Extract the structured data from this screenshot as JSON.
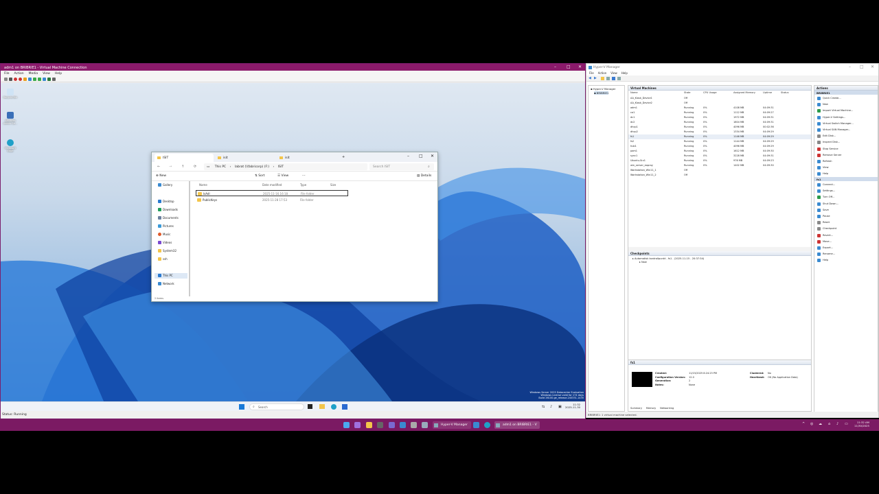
{
  "vm_window": {
    "title": "adm1 on BRIBRIE1 - Virtual Machine Connection",
    "menu": [
      "File",
      "Action",
      "Media",
      "View",
      "Help"
    ],
    "status": "Status: Running"
  },
  "desktop": {
    "icons": [
      "Recycle Bin",
      "Windows Admin Ce...",
      "Microsoft Edge"
    ],
    "watermark": [
      "Windows Server 2025 Datacenter Evaluation",
      "Windows License valid for 174 days",
      "Build 26100.ge_release.240331-1435"
    ],
    "taskbar": {
      "search": "Search",
      "time": "11:32",
      "date": "2025-11-30"
    }
  },
  "explorer": {
    "tabs": [
      "ISIT",
      "isit",
      "isit"
    ],
    "new_tab": "+",
    "address": [
      "This PC",
      "labrat (\\\\fabricorp) (F:)",
      "ISIT"
    ],
    "search_placeholder": "Search ISIT",
    "commands": {
      "new": "New",
      "sort": "Sort",
      "view": "View",
      "more": "···",
      "details": "Details"
    },
    "nav": [
      "Gallery",
      "Desktop",
      "Downloads",
      "Documents",
      "Pictures",
      "Music",
      "Videos",
      "System32",
      "ssh",
      "This PC",
      "Network"
    ],
    "columns": [
      "Name",
      "Date modified",
      "Type",
      "Size"
    ],
    "files": [
      {
        "name": "IsAdl",
        "date": "2025-11-16 16:18",
        "type": "File folder"
      },
      {
        "name": "PublicKeys",
        "date": "2025-11-28 17:53",
        "type": "File folder"
      }
    ],
    "status": "2 items"
  },
  "hyperv": {
    "title": "Hyper-V Manager",
    "menu": [
      "File",
      "Action",
      "View",
      "Help"
    ],
    "tree": [
      "Hyper-V Manager",
      "BRIBRIE1"
    ],
    "vm_section": "Virtual Machines",
    "columns": [
      "Name",
      "State",
      "CPU Usage",
      "Assigned Memory",
      "Uptime",
      "Status"
    ],
    "vms": [
      {
        "name": "AA_Kiosk_Device1",
        "state": "Off",
        "cpu": "",
        "mem": "",
        "up": ""
      },
      {
        "name": "AA_Kiosk_Device2",
        "state": "Off",
        "cpu": "",
        "mem": "",
        "up": ""
      },
      {
        "name": "adm1",
        "state": "Running",
        "cpu": "0%",
        "mem": "4108 MB",
        "up": "04:09:31"
      },
      {
        "name": "ca1",
        "state": "Running",
        "cpu": "0%",
        "mem": "1112 MB",
        "up": "04:09:27"
      },
      {
        "name": "dc1",
        "state": "Running",
        "cpu": "0%",
        "mem": "1972 MB",
        "up": "04:09:31"
      },
      {
        "name": "dc2",
        "state": "Running",
        "cpu": "0%",
        "mem": "1804 MB",
        "up": "04:09:31"
      },
      {
        "name": "dhcp1",
        "state": "Running",
        "cpu": "0%",
        "mem": "4096 MB",
        "up": "00:02:36"
      },
      {
        "name": "dhcp2",
        "state": "Running",
        "cpu": "0%",
        "mem": "1334 MB",
        "up": "04:09:29"
      },
      {
        "name": "fs1",
        "state": "Running",
        "cpu": "0%",
        "mem": "1146 MB",
        "up": "04:09:29"
      },
      {
        "name": "fs2",
        "state": "Running",
        "cpu": "0%",
        "mem": "1144 MB",
        "up": "04:09:29"
      },
      {
        "name": "hub1",
        "state": "Running",
        "cpu": "0%",
        "mem": "4096 MB",
        "up": "04:09:29"
      },
      {
        "name": "pam1",
        "state": "Running",
        "cpu": "0%",
        "mem": "1612 MB",
        "up": "04:09:30"
      },
      {
        "name": "sync1",
        "state": "Running",
        "cpu": "0%",
        "mem": "3228 MB",
        "up": "04:09:31"
      },
      {
        "name": "Ubuntu-Srv1",
        "state": "Running",
        "cpu": "0%",
        "mem": "976 MB",
        "up": "04:09:23"
      },
      {
        "name": "win_server_eopray",
        "state": "Running",
        "cpu": "0%",
        "mem": "1402 MB",
        "up": "04:09:30"
      },
      {
        "name": "Workstation_Win11_1",
        "state": "Off",
        "cpu": "",
        "mem": "",
        "up": ""
      },
      {
        "name": "Workstation_Win11_2",
        "state": "Off",
        "cpu": "",
        "mem": "",
        "up": ""
      }
    ],
    "checkpoints": {
      "title": "Checkpoints",
      "item": "Automatisk kontrollpunkt - fs1 - (2025-11-15 - 20:37:34)",
      "now": "Now"
    },
    "details": {
      "title": "fs1",
      "created_label": "Created:",
      "created": "11/15/2025 8:24:23 PM",
      "config_label": "Configuration Version:",
      "config": "12.0",
      "gen_label": "Generation:",
      "gen": "2",
      "notes_label": "Notes:",
      "notes": "None",
      "clustered_label": "Clustered:",
      "clustered": "No",
      "heartbeat_label": "Heartbeat:",
      "heartbeat": "OK (No Application Data)",
      "tabs": [
        "Summary",
        "Memory",
        "Networking"
      ]
    },
    "actions_title": "Actions",
    "actions_host": "BRIBRIE1",
    "host_actions": [
      "Quick Create...",
      "New",
      "Import Virtual Machine...",
      "Hyper-V Settings...",
      "Virtual Switch Manager...",
      "Virtual SAN Manager...",
      "Edit Disk...",
      "Inspect Disk...",
      "Stop Service",
      "Remove Server",
      "Refresh",
      "View",
      "Help"
    ],
    "actions_vm": "fs1",
    "vm_actions": [
      "Connect...",
      "Settings...",
      "Turn Off...",
      "Shut Down...",
      "Save",
      "Pause",
      "Reset",
      "Checkpoint",
      "Revert...",
      "Move...",
      "Export...",
      "Rename...",
      "Help"
    ],
    "status": "BRIBRIE1: 1 virtual machine selected."
  },
  "host_taskbar": {
    "apps": [
      "Hyper-V Manager",
      "adm1 on BRIBRIE1 - V"
    ],
    "time": "11:32 AM",
    "date": "11/30/2025"
  }
}
